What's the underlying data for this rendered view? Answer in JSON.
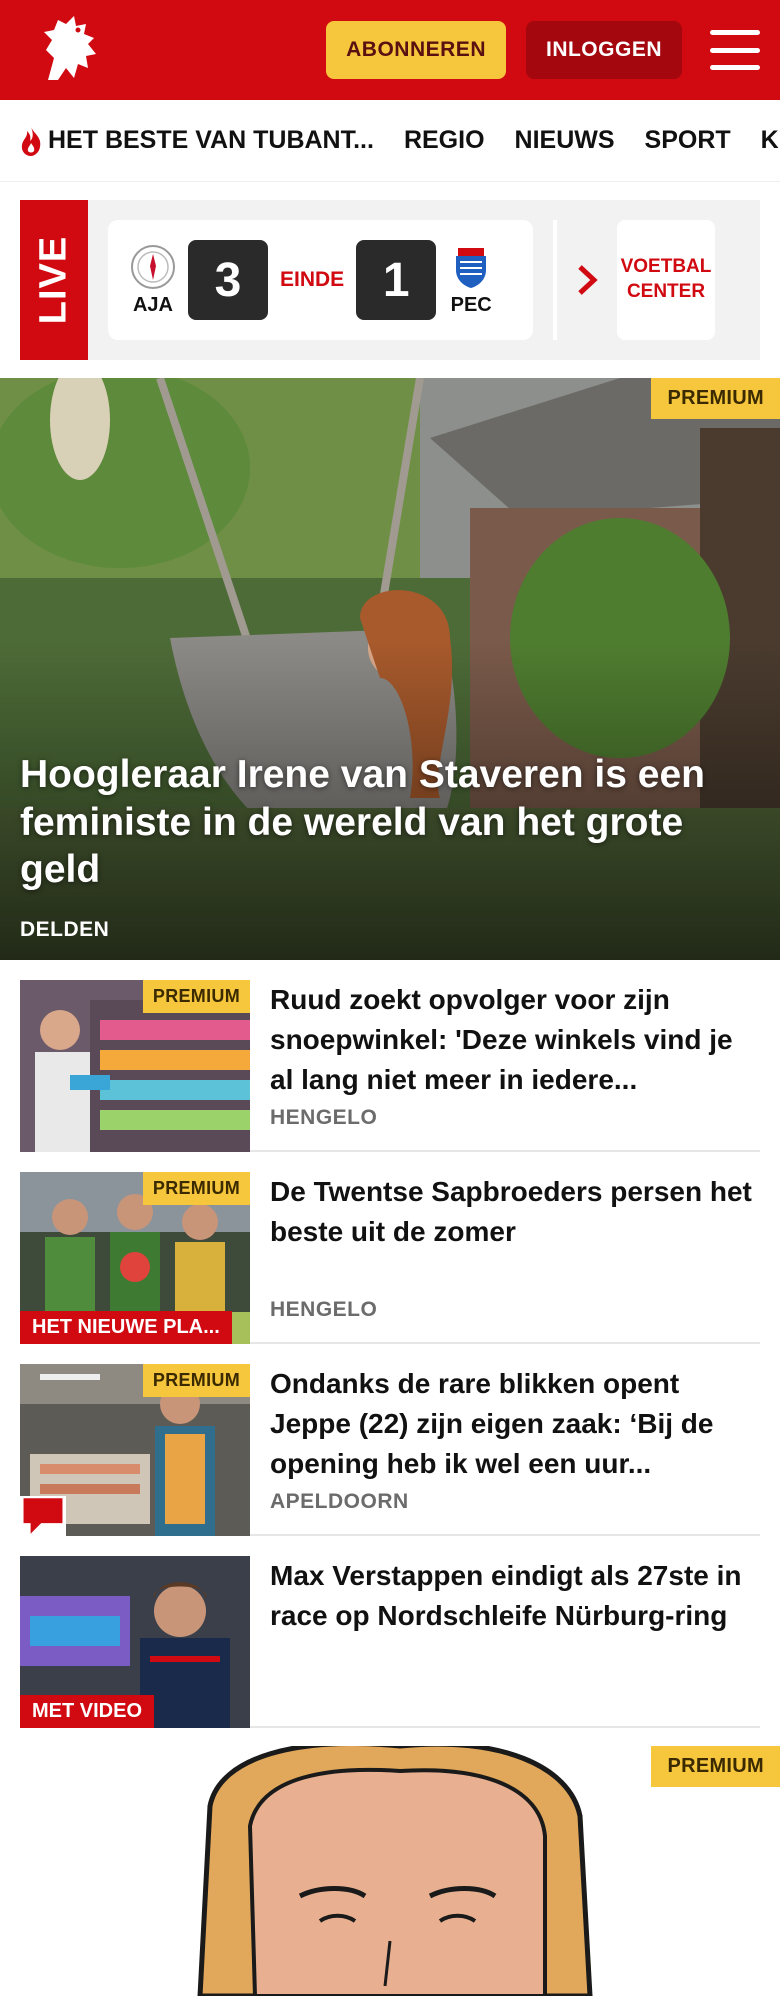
{
  "header": {
    "subscribe_label": "ABONNEREN",
    "login_label": "INLOGGEN",
    "brand_color": "#d10a11"
  },
  "nav": {
    "items": [
      {
        "label": "HET BESTE VAN TUBANT..."
      },
      {
        "label": "REGIO"
      },
      {
        "label": "NIEUWS"
      },
      {
        "label": "SPORT"
      },
      {
        "label": "K"
      }
    ]
  },
  "live": {
    "label": "LIVE",
    "home_team": "AJA",
    "home_score": "3",
    "status": "EINDE",
    "away_score": "1",
    "away_team": "PEC",
    "center_link": "VOETBAL CENTER"
  },
  "hero": {
    "badge": "PREMIUM",
    "title": "Hoogleraar Irene van Staveren is een feministe in de wereld van het grote geld",
    "location": "DELDEN"
  },
  "articles": [
    {
      "badge": "PREMIUM",
      "title": "Ruud zoekt opvolger voor zijn snoepwinkel: 'Deze winkels vind je al lang niet meer in iedere...",
      "location": "HENGELO"
    },
    {
      "badge": "PREMIUM",
      "ribbon": "HET NIEUWE PLA...",
      "title": "De Twentse Sapbroeders persen het beste uit de zomer",
      "location": "HENGELO"
    },
    {
      "badge": "PREMIUM",
      "title": "Ondanks de rare blikken opent Jeppe (22) zijn eigen zaak: ‘Bij de opening heb ik wel een uur...",
      "location": "APELDOORN"
    },
    {
      "ribbon": "MET VIDEO",
      "title": "Max Verstappen eindigt als 27ste in race op Nordschleife Nürburg-ring",
      "location": ""
    }
  ],
  "promo": {
    "badge": "PREMIUM"
  },
  "icons": {
    "logo": "horse-logo-icon",
    "menu": "hamburger-menu-icon",
    "hot": "flame-icon",
    "next": "chevron-right-icon",
    "comment": "comment-icon"
  },
  "colors": {
    "premium": "#f6c63d",
    "red": "#d10a11",
    "dark_red": "#a5070e"
  }
}
